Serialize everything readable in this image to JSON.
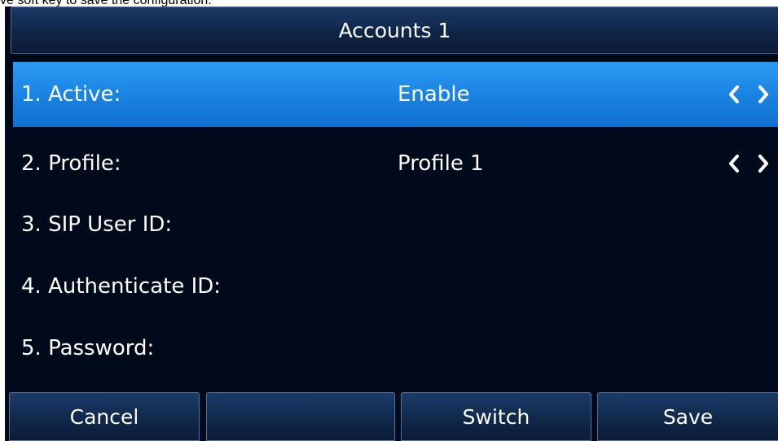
{
  "caption": "ve soft key to save the configuration.",
  "title": "Accounts 1",
  "rows": [
    {
      "label": "1. Active:",
      "value": "Enable",
      "selected": true,
      "has_arrows": true
    },
    {
      "label": "2. Profile:",
      "value": "Profile 1",
      "selected": false,
      "has_arrows": true
    },
    {
      "label": "3. SIP User ID:",
      "value": "",
      "selected": false,
      "has_arrows": false
    },
    {
      "label": "4. Authenticate ID:",
      "value": "",
      "selected": false,
      "has_arrows": false
    },
    {
      "label": "5. Password:",
      "value": "",
      "selected": false,
      "has_arrows": false
    }
  ],
  "softkeys": [
    "Cancel",
    "",
    "Switch",
    "Save"
  ],
  "icons": {
    "prev": "chevron-left-icon",
    "next": "chevron-right-icon"
  },
  "colors": {
    "screen_background": "#000a1a",
    "selected_row": "#1a84e3",
    "bar": "#10284b",
    "text": "#ffffff"
  }
}
